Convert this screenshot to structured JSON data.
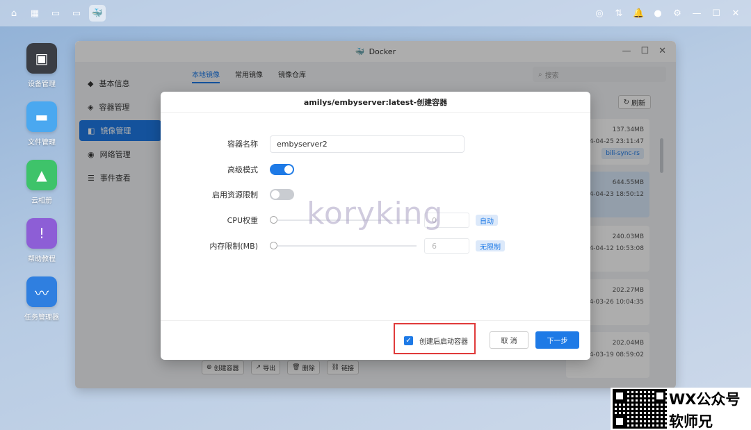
{
  "window": {
    "title": "Docker"
  },
  "sidebar": {
    "items": [
      {
        "label": "基本信息"
      },
      {
        "label": "容器管理"
      },
      {
        "label": "镜像管理"
      },
      {
        "label": "网络管理"
      },
      {
        "label": "事件查看"
      }
    ]
  },
  "tabs": [
    {
      "label": "本地镜像"
    },
    {
      "label": "常用镜像"
    },
    {
      "label": "镜像仓库"
    }
  ],
  "search": {
    "placeholder": "搜索"
  },
  "refresh_label": "刷新",
  "images": [
    {
      "size": "137.34MB",
      "date": "2024-04-25 23:11:47",
      "tag": "bili-sync-rs"
    },
    {
      "size": "644.55MB",
      "date": "2024-04-23 18:50:12"
    },
    {
      "size": "240.03MB",
      "date": "2024-04-12 10:53:08"
    },
    {
      "size": "202.27MB",
      "date": "2024-03-26 10:04:35"
    },
    {
      "size": "202.04MB",
      "date": "2024-03-19 08:59:02"
    }
  ],
  "actions": [
    {
      "label": "创建容器"
    },
    {
      "label": "导出"
    },
    {
      "label": "删除"
    },
    {
      "label": "链接"
    }
  ],
  "desktop": [
    {
      "label": "设备管理"
    },
    {
      "label": "文件管理"
    },
    {
      "label": "云相册"
    },
    {
      "label": "帮助教程"
    },
    {
      "label": "任务管理器"
    }
  ],
  "modal": {
    "title": "amilys/embyserver:latest-创建容器",
    "name_label": "容器名称",
    "name_value": "embyserver2",
    "advanced_label": "高级模式",
    "advanced_on": true,
    "limit_label": "启用资源限制",
    "limit_on": false,
    "cpu_label": "CPU权重",
    "cpu_value": "0",
    "cpu_tag": "自动",
    "mem_label": "内存限制(MB)",
    "mem_value": "6",
    "mem_tag": "无限制",
    "start_after_label": "创建后启动容器",
    "start_after_checked": true,
    "cancel_label": "取 消",
    "next_label": "下一步"
  },
  "watermark": "koryking",
  "brand": {
    "line1": "WX公众号",
    "line2": "软师兄"
  },
  "colors": {
    "accent": "#1e7ae6",
    "highlight": "#e03a3a"
  }
}
